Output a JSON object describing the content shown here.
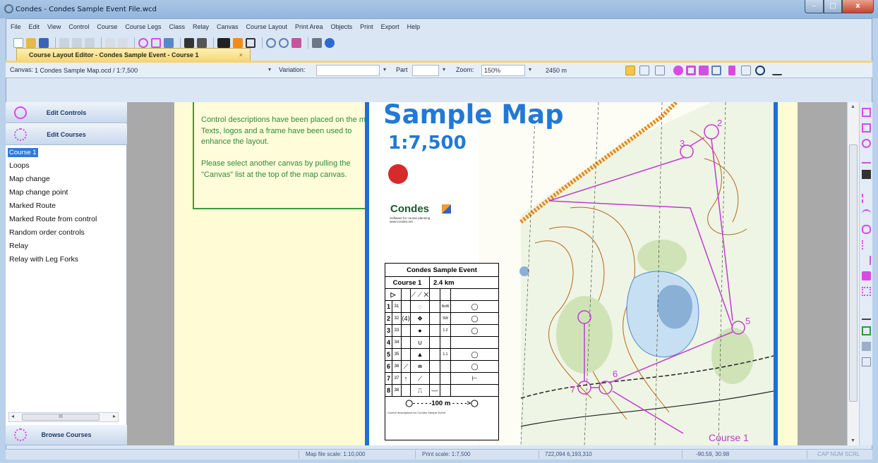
{
  "window": {
    "title": "Condes - Condes Sample Event File.wcd",
    "minimize_label": "–",
    "maximize_label": "□",
    "close_label": "x"
  },
  "menu": [
    "File",
    "Edit",
    "View",
    "Control",
    "Course",
    "Course Legs",
    "Class",
    "Relay",
    "Canvas",
    "Course Layout",
    "Print Area",
    "Objects",
    "Print",
    "Export",
    "Help"
  ],
  "doc_tab": {
    "label": "Course Layout Editor - Condes Sample Event - Course 1",
    "close": "×"
  },
  "canvasbar": {
    "canvas_label": "Canvas:",
    "canvas_value": "1 Condes Sample Map.ocd  / 1:7,500",
    "variation_label": "Variation:",
    "variation_value": "",
    "part_label": "Part",
    "part_value": "",
    "zoom_label": "Zoom:",
    "zoom_value": "150%",
    "distance_value": "2450 m"
  },
  "sidebar": {
    "edit_controls": "Edit Controls",
    "edit_courses": "Edit Courses",
    "courses": [
      "Course 1",
      "Loops",
      "Map change",
      "Map change point",
      "Marked Route",
      "Marked Route from control",
      "Random order controls",
      "Relay",
      "Relay with Leg Forks"
    ],
    "selected_index": 0,
    "scroll_thumb": "III",
    "browse_courses": "Browse Courses"
  },
  "canvas": {
    "info_text": "Control descriptions have been placed on the map.\nTexts, logos and a frame have been used to enhance the layout.\n\nPlease select another canvas by pulling the \"Canvas\" list at the top of the map canvas.",
    "map_title": "Sample Map",
    "map_scale": "1:7,500",
    "logo_text": "Condes",
    "logo_subtext": "Software for course planning www.condes.net",
    "course_label": "Course 1",
    "control_labels": [
      "2",
      "3",
      "5",
      "6",
      "7"
    ]
  },
  "description_sheet": {
    "event": "Condes Sample Event",
    "course": "Course 1",
    "length": "2.4 km",
    "start_symbol": "▷",
    "rows": [
      {
        "n": "1",
        "code": "31",
        "c": "",
        "d": "◌",
        "e": "",
        "f": "NxW",
        "g": "◯"
      },
      {
        "n": "2",
        "code": "32",
        "c": "⟨4⟩",
        "d": "❖",
        "e": "",
        "f": "SW",
        "g": "◯"
      },
      {
        "n": "3",
        "code": "33",
        "c": "",
        "d": "●",
        "e": "",
        "f": "1.2",
        "g": "◯"
      },
      {
        "n": "4",
        "code": "34",
        "c": "",
        "d": "∪",
        "e": "",
        "f": "",
        "g": ""
      },
      {
        "n": "5",
        "code": "35",
        "c": "",
        "d": "▲",
        "e": "",
        "f": "1.1",
        "g": "◯"
      },
      {
        "n": "6",
        "code": "36",
        "c": "⟋",
        "d": "≐",
        "e": "",
        "f": "",
        "g": "◯"
      },
      {
        "n": "7",
        "code": "37",
        "c": "↑",
        "d": "⟋",
        "e": "",
        "f": "",
        "g": "⊢"
      },
      {
        "n": "8",
        "code": "38",
        "c": "",
        "d": "⎍",
        "e": "—",
        "f": "",
        "g": ""
      }
    ],
    "finish": "◯- - - - -100 m - - - ->◯",
    "footnote": "Control descriptions for Condes Sample Event"
  },
  "status": {
    "map_file_scale": "Map file scale: 1:10,000",
    "print_scale": "Print scale: 1:7,500",
    "coords": "722,094  6,193,310",
    "mm": "-90.59, 30.98",
    "keys": "CAP  NUM  SCRL"
  },
  "colors": {
    "accent": "#2179d6",
    "course_magenta": "#c13bcf",
    "info_green": "#2e8b3a",
    "paper": "#fffbd4"
  }
}
